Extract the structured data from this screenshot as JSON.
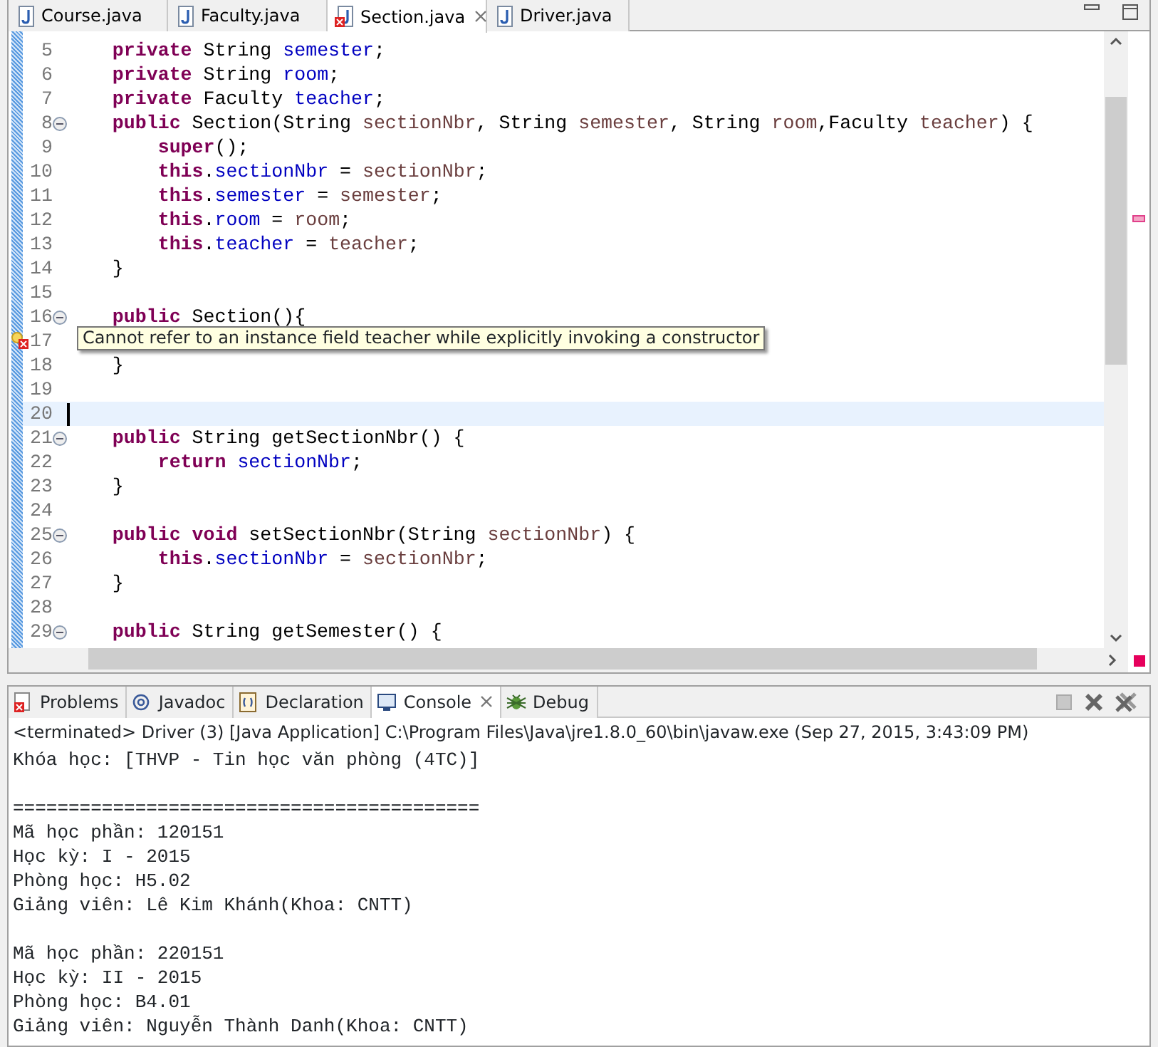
{
  "editor_tabs": [
    {
      "label": "Course.java",
      "selected": false,
      "error": false
    },
    {
      "label": "Faculty.java",
      "selected": false,
      "error": false
    },
    {
      "label": "Section.java",
      "selected": true,
      "error": true
    },
    {
      "label": "Driver.java",
      "selected": false,
      "error": false
    }
  ],
  "code_lines": [
    {
      "number": "5",
      "fold": false,
      "error": false,
      "current": false,
      "tokens": [
        {
          "kind": "keyword",
          "text": "    private"
        },
        {
          "kind": "plain",
          "text": " String "
        },
        {
          "kind": "field",
          "text": "semester"
        },
        {
          "kind": "plain",
          "text": ";"
        }
      ]
    },
    {
      "number": "6",
      "fold": false,
      "error": false,
      "current": false,
      "tokens": [
        {
          "kind": "keyword",
          "text": "    private"
        },
        {
          "kind": "plain",
          "text": " String "
        },
        {
          "kind": "field",
          "text": "room"
        },
        {
          "kind": "plain",
          "text": ";"
        }
      ]
    },
    {
      "number": "7",
      "fold": false,
      "error": false,
      "current": false,
      "tokens": [
        {
          "kind": "keyword",
          "text": "    private"
        },
        {
          "kind": "plain",
          "text": " Faculty "
        },
        {
          "kind": "field",
          "text": "teacher"
        },
        {
          "kind": "plain",
          "text": ";"
        }
      ]
    },
    {
      "number": "8",
      "fold": true,
      "error": false,
      "current": false,
      "tokens": [
        {
          "kind": "keyword",
          "text": "    public"
        },
        {
          "kind": "plain",
          "text": " Section(String "
        },
        {
          "kind": "param",
          "text": "sectionNbr"
        },
        {
          "kind": "plain",
          "text": ", String "
        },
        {
          "kind": "param",
          "text": "semester"
        },
        {
          "kind": "plain",
          "text": ", String "
        },
        {
          "kind": "param",
          "text": "room"
        },
        {
          "kind": "plain",
          "text": ",Faculty "
        },
        {
          "kind": "param",
          "text": "teacher"
        },
        {
          "kind": "plain",
          "text": ") {"
        }
      ]
    },
    {
      "number": "9",
      "fold": false,
      "error": false,
      "current": false,
      "tokens": [
        {
          "kind": "keyword",
          "text": "        super"
        },
        {
          "kind": "plain",
          "text": "();"
        }
      ]
    },
    {
      "number": "10",
      "fold": false,
      "error": false,
      "current": false,
      "tokens": [
        {
          "kind": "keyword",
          "text": "        this"
        },
        {
          "kind": "plain",
          "text": "."
        },
        {
          "kind": "field",
          "text": "sectionNbr"
        },
        {
          "kind": "plain",
          "text": " = "
        },
        {
          "kind": "param",
          "text": "sectionNbr"
        },
        {
          "kind": "plain",
          "text": ";"
        }
      ]
    },
    {
      "number": "11",
      "fold": false,
      "error": false,
      "current": false,
      "tokens": [
        {
          "kind": "keyword",
          "text": "        this"
        },
        {
          "kind": "plain",
          "text": "."
        },
        {
          "kind": "field",
          "text": "semester"
        },
        {
          "kind": "plain",
          "text": " = "
        },
        {
          "kind": "param",
          "text": "semester"
        },
        {
          "kind": "plain",
          "text": ";"
        }
      ]
    },
    {
      "number": "12",
      "fold": false,
      "error": false,
      "current": false,
      "tokens": [
        {
          "kind": "keyword",
          "text": "        this"
        },
        {
          "kind": "plain",
          "text": "."
        },
        {
          "kind": "field",
          "text": "room"
        },
        {
          "kind": "plain",
          "text": " = "
        },
        {
          "kind": "param",
          "text": "room"
        },
        {
          "kind": "plain",
          "text": ";"
        }
      ]
    },
    {
      "number": "13",
      "fold": false,
      "error": false,
      "current": false,
      "tokens": [
        {
          "kind": "keyword",
          "text": "        this"
        },
        {
          "kind": "plain",
          "text": "."
        },
        {
          "kind": "field",
          "text": "teacher"
        },
        {
          "kind": "plain",
          "text": " = "
        },
        {
          "kind": "param",
          "text": "teacher"
        },
        {
          "kind": "plain",
          "text": ";"
        }
      ]
    },
    {
      "number": "14",
      "fold": false,
      "error": false,
      "current": false,
      "tokens": [
        {
          "kind": "plain",
          "text": "    }"
        }
      ]
    },
    {
      "number": "15",
      "fold": false,
      "error": false,
      "current": false
    },
    {
      "number": "16",
      "fold": true,
      "error": false,
      "current": false,
      "tokens": [
        {
          "kind": "keyword",
          "text": "    public"
        },
        {
          "kind": "plain",
          "text": " Section(){"
        }
      ]
    },
    {
      "number": "17",
      "fold": false,
      "error": true,
      "current": false
    },
    {
      "number": "18",
      "fold": false,
      "error": false,
      "current": false,
      "tokens": [
        {
          "kind": "plain",
          "text": "    }"
        }
      ]
    },
    {
      "number": "19",
      "fold": false,
      "error": false,
      "current": false
    },
    {
      "number": "20",
      "fold": false,
      "error": false,
      "current": true
    },
    {
      "number": "21",
      "fold": true,
      "error": false,
      "current": false,
      "tokens": [
        {
          "kind": "keyword",
          "text": "    public"
        },
        {
          "kind": "plain",
          "text": " String getSectionNbr() {"
        }
      ]
    },
    {
      "number": "22",
      "fold": false,
      "error": false,
      "current": false,
      "tokens": [
        {
          "kind": "keyword",
          "text": "        return"
        },
        {
          "kind": "field",
          "text": " sectionNbr"
        },
        {
          "kind": "plain",
          "text": ";"
        }
      ]
    },
    {
      "number": "23",
      "fold": false,
      "error": false,
      "current": false,
      "tokens": [
        {
          "kind": "plain",
          "text": "    }"
        }
      ]
    },
    {
      "number": "24",
      "fold": false,
      "error": false,
      "current": false
    },
    {
      "number": "25",
      "fold": true,
      "error": false,
      "current": false,
      "tokens": [
        {
          "kind": "keyword",
          "text": "    public void"
        },
        {
          "kind": "plain",
          "text": " setSectionNbr(String "
        },
        {
          "kind": "param",
          "text": "sectionNbr"
        },
        {
          "kind": "plain",
          "text": ") {"
        }
      ]
    },
    {
      "number": "26",
      "fold": false,
      "error": false,
      "current": false,
      "tokens": [
        {
          "kind": "keyword",
          "text": "        this"
        },
        {
          "kind": "plain",
          "text": "."
        },
        {
          "kind": "field",
          "text": "sectionNbr"
        },
        {
          "kind": "plain",
          "text": " = "
        },
        {
          "kind": "param",
          "text": "sectionNbr"
        },
        {
          "kind": "plain",
          "text": ";"
        }
      ]
    },
    {
      "number": "27",
      "fold": false,
      "error": false,
      "current": false,
      "tokens": [
        {
          "kind": "plain",
          "text": "    }"
        }
      ]
    },
    {
      "number": "28",
      "fold": false,
      "error": false,
      "current": false
    },
    {
      "number": "29",
      "fold": true,
      "error": false,
      "current": false,
      "tokens": [
        {
          "kind": "keyword",
          "text": "    public"
        },
        {
          "kind": "plain",
          "text": " String getSemester() {"
        }
      ]
    }
  ],
  "tooltip": "Cannot refer to an instance field teacher while explicitly invoking a constructor",
  "console_tabs": [
    {
      "label": "Problems",
      "kind": "problems",
      "selected": false
    },
    {
      "label": "Javadoc",
      "kind": "javadoc",
      "selected": false
    },
    {
      "label": "Declaration",
      "kind": "declaration",
      "selected": false
    },
    {
      "label": "Console",
      "kind": "console",
      "selected": true
    },
    {
      "label": "Debug",
      "kind": "debug",
      "selected": false
    }
  ],
  "console": {
    "header": "<terminated> Driver (3) [Java Application] C:\\Program Files\\Java\\jre1.8.0_60\\bin\\javaw.exe (Sep 27, 2015, 3:43:09 PM)",
    "blocks": [
      [
        "Khóa học: [THVP - Tin học văn phòng (4TC)]"
      ],
      [
        "==========================================",
        "Mã học phần: 120151",
        "Học kỳ: I - 2015",
        "Phòng học: H5.02",
        "Giảng viên: Lê Kim Khánh(Khoa: CNTT)"
      ],
      [
        "Mã học phần: 220151",
        "Học kỳ: II - 2015",
        "Phòng học: B4.01",
        "Giảng viên: Nguyễn Thành Danh(Khoa: CNTT)"
      ]
    ]
  }
}
